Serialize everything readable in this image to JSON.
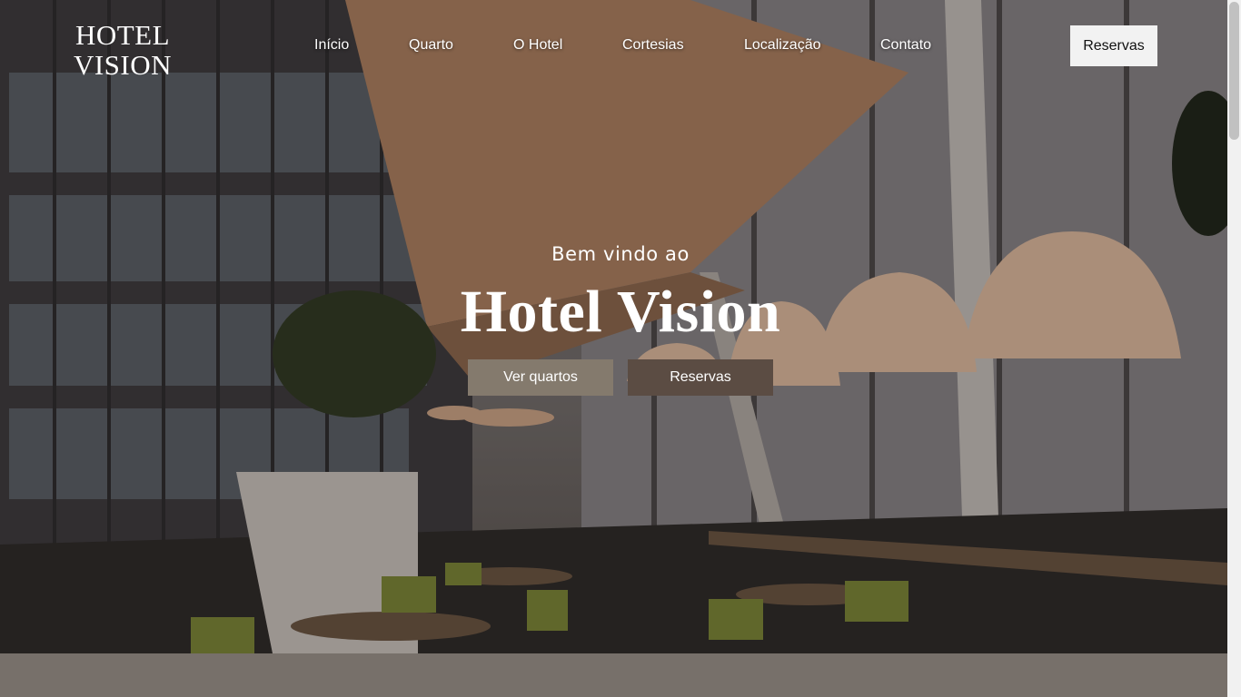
{
  "header": {
    "logo_line1": "HOTEL",
    "logo_line2": "VISION",
    "nav": [
      {
        "label": "Início"
      },
      {
        "label": "Quarto"
      },
      {
        "label": "O Hotel"
      },
      {
        "label": "Cortesias"
      },
      {
        "label": "Localização"
      },
      {
        "label": "Contato"
      }
    ],
    "reserve_label": "Reservas"
  },
  "hero": {
    "welcome": "Bem vindo ao",
    "title": "Hotel Vision",
    "primary_button": "Ver quartos",
    "secondary_button": "Reservas"
  },
  "colors": {
    "accent_light": "#847a6d",
    "accent_dark": "#5b4c43",
    "band": "#77706a"
  }
}
